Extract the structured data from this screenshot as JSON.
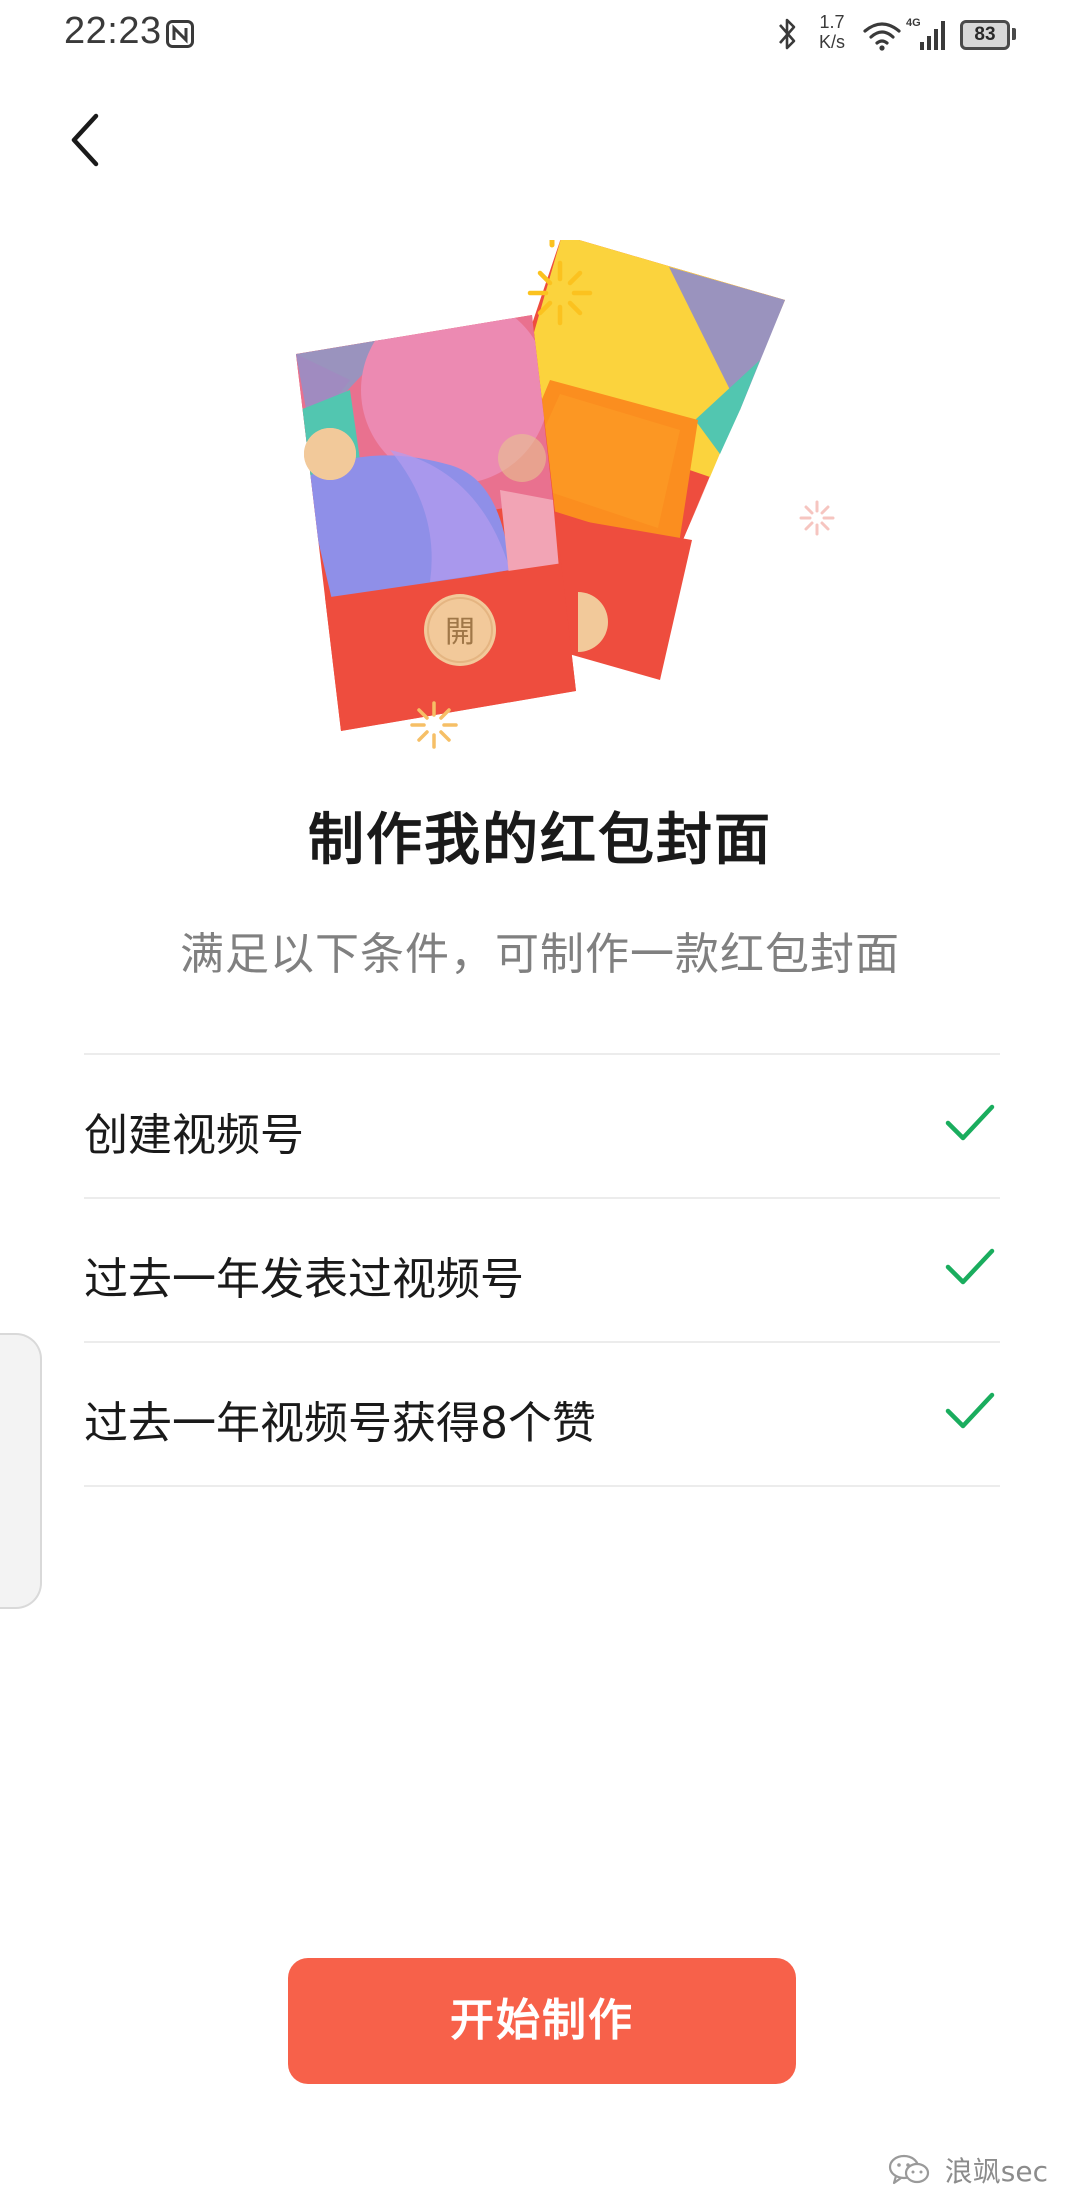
{
  "status_bar": {
    "time": "22:23",
    "net_speed_value": "1.7",
    "net_speed_unit": "K/s",
    "network_type": "4G",
    "battery": "83"
  },
  "header": {
    "back_icon": "chevron-left-icon"
  },
  "illustration": {
    "coin_label": "開"
  },
  "main": {
    "title": "制作我的红包封面",
    "subtitle": "满足以下条件，可制作一款红包封面",
    "conditions": [
      {
        "label": "创建视频号",
        "met": true
      },
      {
        "label": "过去一年发表过视频号",
        "met": true
      },
      {
        "label": "过去一年视频号获得8个赞",
        "met": true
      }
    ]
  },
  "footer": {
    "start_button": "开始制作"
  },
  "watermark": {
    "text": "浪飒sec"
  },
  "colors": {
    "accent": "#f7614a",
    "check": "#1aad5e"
  }
}
